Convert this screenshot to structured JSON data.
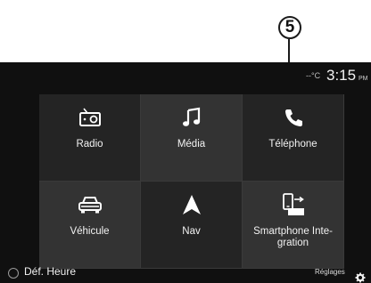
{
  "callout": {
    "number": "5"
  },
  "status": {
    "time": "3:15",
    "ampm": "PM",
    "temp": "--°C"
  },
  "menu": [
    {
      "label": "Radio",
      "icon": "radio-icon"
    },
    {
      "label": "Média",
      "icon": "music-note-icon"
    },
    {
      "label": "Téléphone",
      "icon": "phone-icon"
    },
    {
      "label": "Véhicule",
      "icon": "car-icon"
    },
    {
      "label": "Nav",
      "icon": "navigation-arrow-icon"
    },
    {
      "label": "Smartphone Inte-\ngration",
      "icon": "smartphone-projection-icon"
    }
  ],
  "bottom": {
    "left_label": "Déf. Heure",
    "right_label": "Réglages"
  },
  "colors": {
    "screen_bg": "#101010",
    "tile_dark": "#242424",
    "tile_light": "#333333",
    "text": "#f2f2f2"
  }
}
